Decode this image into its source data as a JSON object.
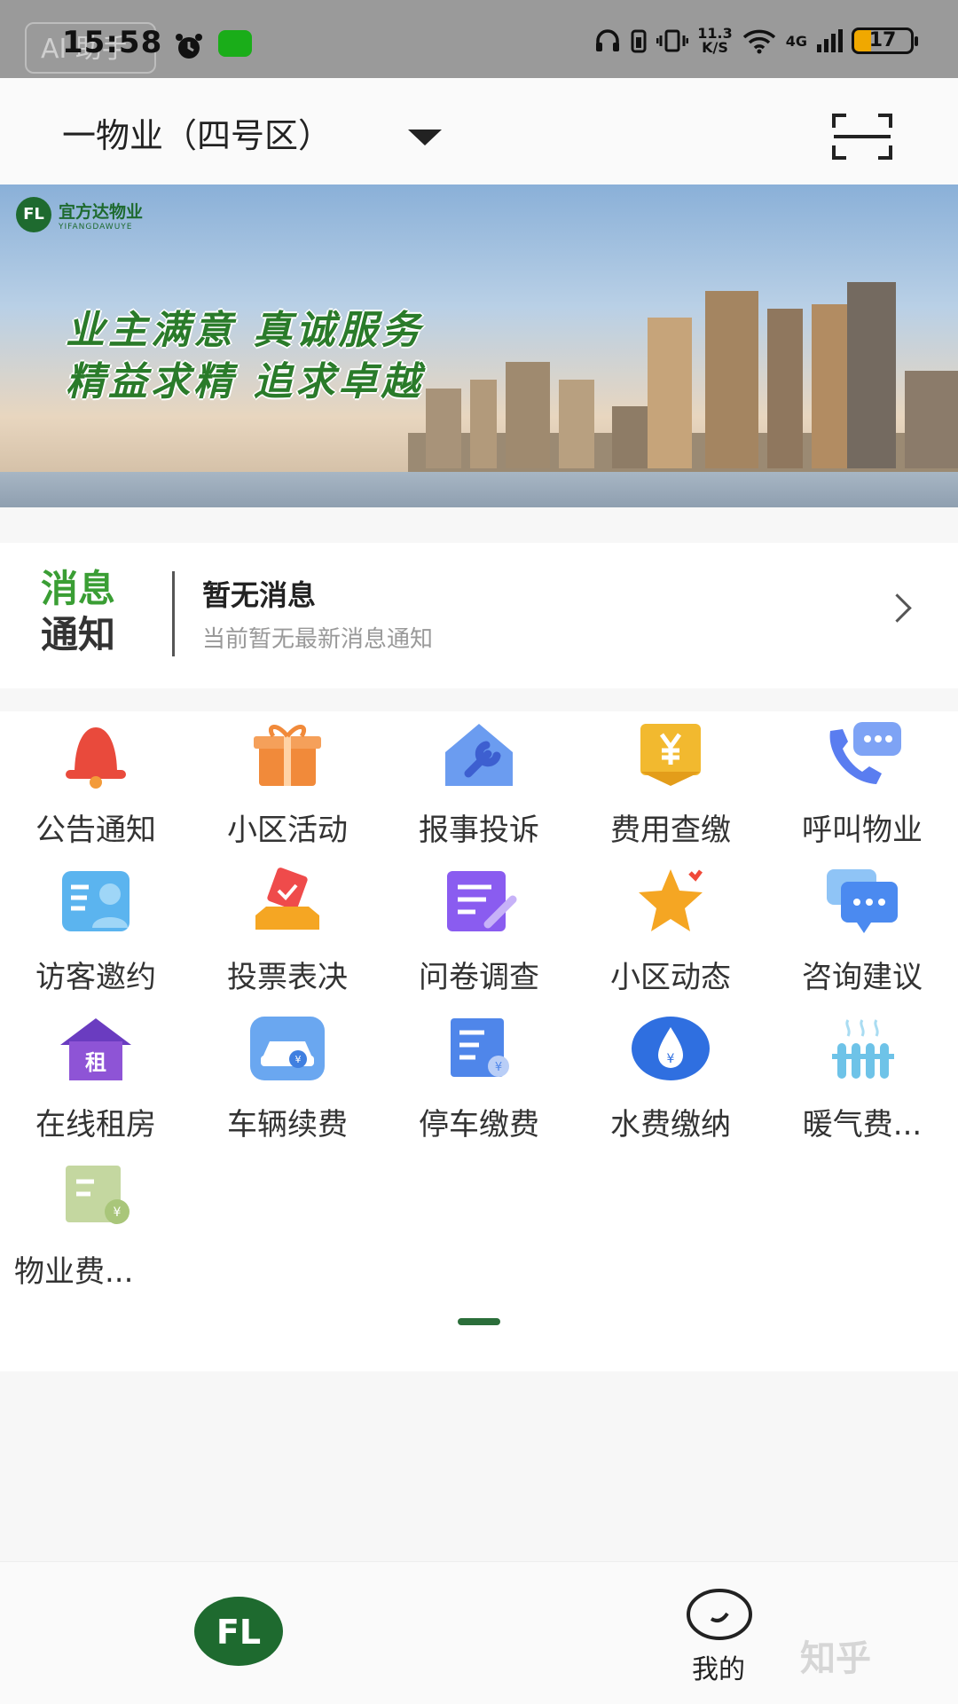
{
  "status_bar": {
    "time": "15:58",
    "overlay_badge": "AI 助手",
    "net_speed_top": "11.3",
    "net_speed_bottom": "K/S",
    "network": "4G",
    "battery": "17"
  },
  "header": {
    "community": "一物业（四号区）"
  },
  "banner": {
    "brand_name": "宜方达物业",
    "brand_pinyin": "YIFANGDAWUYE",
    "brand_mark": "FL",
    "slogan_line1": "业主满意  真诚服务",
    "slogan_line2": "精益求精  追求卓越"
  },
  "notice": {
    "tag_line1": "消息",
    "tag_line2": "通知",
    "title": "暂无消息",
    "subtitle": "当前暂无最新消息通知"
  },
  "services": [
    {
      "label": "公告通知",
      "icon": "bell-icon",
      "color": "#e94a3c"
    },
    {
      "label": "小区活动",
      "icon": "gift-icon",
      "color": "#f18a3a"
    },
    {
      "label": "报事投诉",
      "icon": "wrench-house-icon",
      "color": "#6b9cf0"
    },
    {
      "label": "费用查缴",
      "icon": "yen-badge-icon",
      "color": "#f2b92f"
    },
    {
      "label": "呼叫物业",
      "icon": "phone-chat-icon",
      "color": "#5a7df0"
    },
    {
      "label": "访客邀约",
      "icon": "visitor-card-icon",
      "color": "#5bb4ef"
    },
    {
      "label": "投票表决",
      "icon": "ballot-icon",
      "color": "#ef4b4b"
    },
    {
      "label": "问卷调查",
      "icon": "survey-icon",
      "color": "#8a5cf0"
    },
    {
      "label": "小区动态",
      "icon": "star-icon",
      "color": "#f5a623"
    },
    {
      "label": "咨询建议",
      "icon": "chat-bubbles-icon",
      "color": "#4b8af0"
    },
    {
      "label": "在线租房",
      "icon": "rent-house-icon",
      "color": "#8e54d6"
    },
    {
      "label": "车辆续费",
      "icon": "car-icon",
      "color": "#6aa7f0"
    },
    {
      "label": "停车缴费",
      "icon": "parking-bill-icon",
      "color": "#4f86ea"
    },
    {
      "label": "水费缴纳",
      "icon": "water-drop-icon",
      "color": "#2f6fe0"
    },
    {
      "label": "暖气费...",
      "icon": "radiator-icon",
      "color": "#6ec3e8"
    },
    {
      "label": "物业费...",
      "icon": "property-bill-icon",
      "color": "#b7cf8e"
    }
  ],
  "bottom_nav": {
    "home_mark": "FL",
    "me_label": "我的",
    "watermark": "知乎"
  }
}
